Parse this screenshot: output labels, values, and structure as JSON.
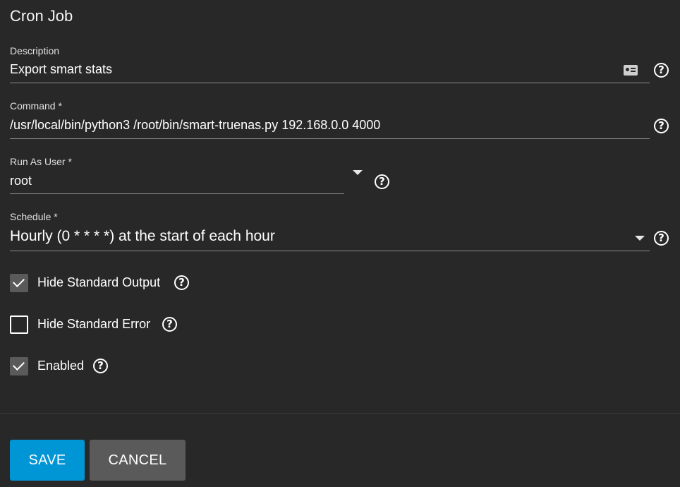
{
  "dialog": {
    "title": "Cron Job"
  },
  "fields": {
    "description": {
      "label": "Description",
      "value": "Export smart stats"
    },
    "command": {
      "label": "Command *",
      "value": "/usr/local/bin/python3 /root/bin/smart-truenas.py 192.168.0.0 4000"
    },
    "run_as_user": {
      "label": "Run As User *",
      "value": "root"
    },
    "schedule": {
      "label": "Schedule *",
      "value": "Hourly (0 * * * *) at the start of each hour"
    }
  },
  "checkboxes": {
    "hide_stdout": {
      "label": "Hide Standard Output",
      "checked": true
    },
    "hide_stderr": {
      "label": "Hide Standard Error",
      "checked": false
    },
    "enabled": {
      "label": "Enabled",
      "checked": true
    }
  },
  "actions": {
    "save_label": "SAVE",
    "cancel_label": "CANCEL"
  },
  "icons": {
    "help": "?",
    "help_icon_name": "help-circle-icon",
    "contact_card": "contact-card-icon"
  },
  "colors": {
    "accent": "#0095d5",
    "background": "#282828",
    "secondary_button": "#5a5a5a"
  }
}
